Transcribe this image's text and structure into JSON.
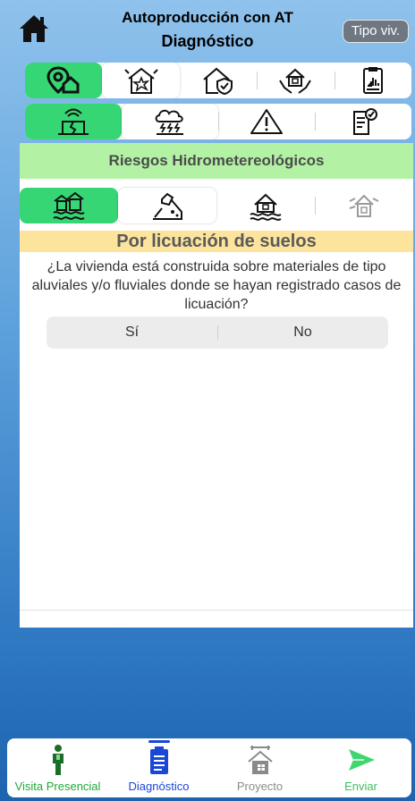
{
  "header": {
    "title_line1": "Autoproducción con AT",
    "title_line2": "Diagnóstico",
    "tipo_button": "Tipo viv."
  },
  "colors": {
    "active_tab": "#36d675",
    "risk_header_bg": "#b3f2a5",
    "section_title_bg": "#fde49d",
    "nav_active": "#1a47d6",
    "nav_green": "#1fa83a"
  },
  "main_tabs": [
    {
      "icon": "location-house-icon",
      "state": "active"
    },
    {
      "icon": "house-damage-icon",
      "state": "selected"
    },
    {
      "icon": "house-shield-icon",
      "state": "normal"
    },
    {
      "icon": "house-hands-icon",
      "state": "normal"
    },
    {
      "icon": "clipboard-report-icon",
      "state": "normal"
    }
  ],
  "risk_tabs": [
    {
      "icon": "earthquake-crack-icon",
      "state": "active"
    },
    {
      "icon": "storm-cloud-icon",
      "state": "selected"
    },
    {
      "icon": "warning-triangle-icon",
      "state": "normal"
    },
    {
      "icon": "checklist-icon",
      "state": "normal"
    }
  ],
  "risk_header": "Riesgos Hidrometereológicos",
  "hydro_tabs": [
    {
      "icon": "house-flood-waves-icon",
      "state": "active"
    },
    {
      "icon": "landslide-house-icon",
      "state": "selected"
    },
    {
      "icon": "house-water-icon",
      "state": "normal"
    },
    {
      "icon": "house-gray-icon",
      "state": "normal"
    }
  ],
  "section_title": "Por licuación de suelos",
  "question": "¿La vivienda está construida sobre materiales de tipo aluviales y/o fluviales donde se hayan registrado casos de licuación?",
  "answers": {
    "yes": "Sí",
    "no": "No"
  },
  "bottom_nav": [
    {
      "label": "Visita Presencial",
      "icon": "person-standing-icon",
      "state": "normal"
    },
    {
      "label": "Diagnóstico",
      "icon": "clipboard-list-icon",
      "state": "active"
    },
    {
      "label": "Proyecto",
      "icon": "house-tools-icon",
      "state": "disabled"
    },
    {
      "label": "Enviar",
      "icon": "send-icon",
      "state": "normal"
    }
  ]
}
